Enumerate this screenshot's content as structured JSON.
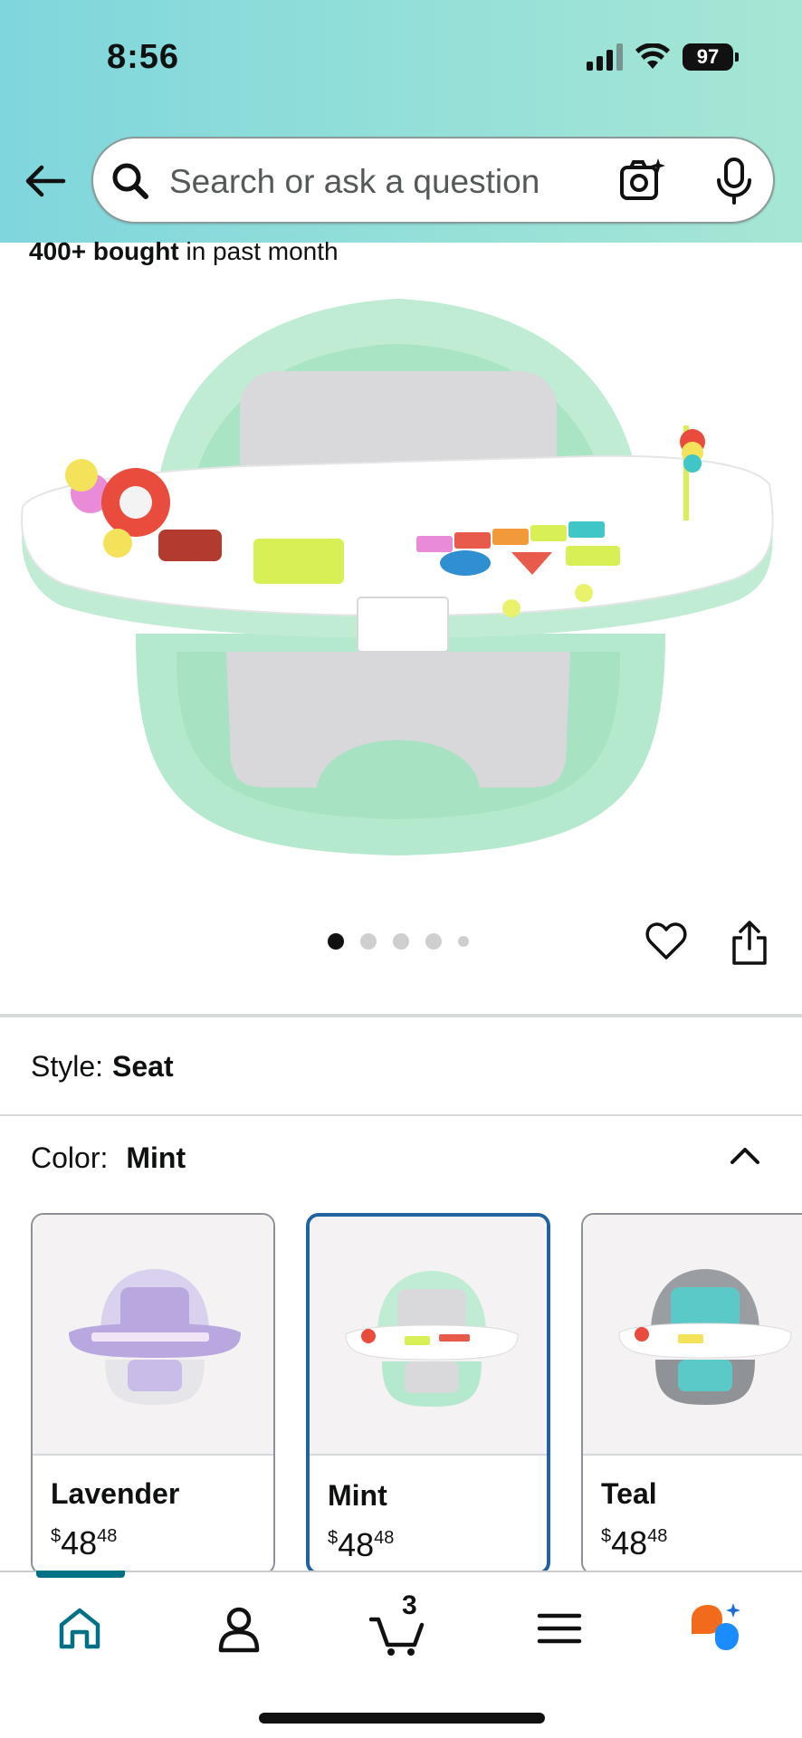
{
  "status_bar": {
    "time": "8:56",
    "battery": "97"
  },
  "search": {
    "placeholder": "Search or ask a question"
  },
  "product": {
    "bought_count": "400+ bought",
    "bought_suffix": " in past month",
    "image_count": 5,
    "active_image": 1
  },
  "style": {
    "label": "Style:",
    "value": "Seat"
  },
  "color": {
    "label": "Color:",
    "value": "Mint",
    "options": [
      {
        "name": "Lavender",
        "price_symbol": "$",
        "price_whole": "48",
        "price_fraction": "48",
        "accent": "#b9a8e0",
        "selected": false
      },
      {
        "name": "Mint",
        "price_symbol": "$",
        "price_whole": "48",
        "price_fraction": "48",
        "accent": "#a8e6c4",
        "selected": true
      },
      {
        "name": "Teal",
        "price_symbol": "$",
        "price_whole": "48",
        "price_fraction": "48",
        "accent": "#5cc9c9",
        "selected": false
      }
    ]
  },
  "bottom_nav": {
    "items": [
      "home-icon",
      "account-icon",
      "cart-icon",
      "menu-icon",
      "rufus-icon"
    ],
    "cart_count": "3",
    "active": "home"
  },
  "colors": {
    "header_start": "#7fd6dc",
    "header_end": "#a6e6d4",
    "selected_border": "#2162a1",
    "nav_active": "#007185"
  }
}
